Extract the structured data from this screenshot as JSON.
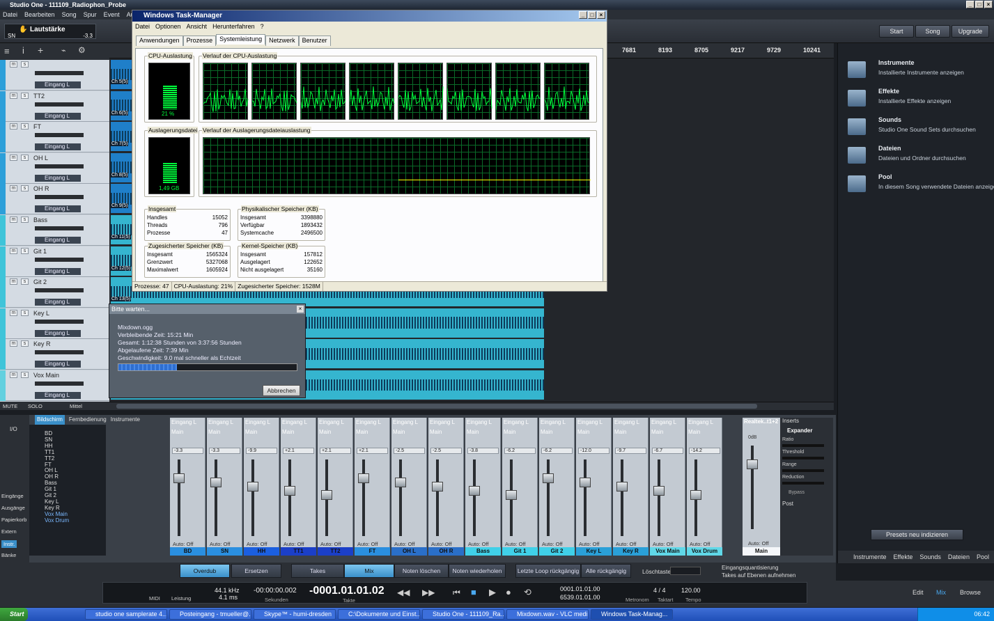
{
  "app": {
    "title": "Studio One - 111109_Radiophon_Probe",
    "menu": [
      "Datei",
      "Bearbeiten",
      "Song",
      "Spur",
      "Event",
      "Audio"
    ]
  },
  "toolbar": {
    "volume_label": "Lautstärke",
    "sn": "SN",
    "volume_value": "-3.3",
    "start": "Start",
    "song": "Song",
    "upgrade": "Upgrade"
  },
  "ruler": [
    "7681",
    "8193",
    "8705",
    "9217",
    "9729",
    "10241"
  ],
  "tracks": [
    {
      "name": "",
      "input": "Eingang L",
      "color": "#2d9fd9"
    },
    {
      "name": "TT2",
      "input": "Eingang L",
      "color": "#2d9fd9"
    },
    {
      "name": "FT",
      "input": "Eingang L",
      "color": "#2d9fd9"
    },
    {
      "name": "OH L",
      "input": "Eingang L",
      "color": "#2d9fd9"
    },
    {
      "name": "OH R",
      "input": "Eingang L",
      "color": "#2d9fd9"
    },
    {
      "name": "Bass",
      "input": "Eingang L",
      "color": "#3fc4d9"
    },
    {
      "name": "Git 1",
      "input": "Eingang L",
      "color": "#3fc4d9"
    },
    {
      "name": "Git 2",
      "input": "Eingang L",
      "color": "#3fc4d9"
    },
    {
      "name": "Key L",
      "input": "Eingang L",
      "color": "#3fc4d9"
    },
    {
      "name": "Key R",
      "input": "Eingang L",
      "color": "#3fc4d9"
    },
    {
      "name": "Vox Main",
      "input": "Eingang L",
      "color": "#63d0df"
    }
  ],
  "last_track": "Vox Drum",
  "tracklist_footer": {
    "mute": "MUTE",
    "solo": "SOLO",
    "mittel": "Mittel"
  },
  "clip_labels": [
    "Ch 5(5)",
    "Ch 6(5)",
    "Ch 7(5)",
    "Ch 8(5)",
    "Ch 9(5)",
    "Ch 11(5)",
    "Ch 12(5)",
    "Ch 13(5)"
  ],
  "taskmanager": {
    "title": "Windows Task-Manager",
    "menu": [
      "Datei",
      "Optionen",
      "Ansicht",
      "Herunterfahren",
      "?"
    ],
    "tabs": [
      "Anwendungen",
      "Prozesse",
      "Systemleistung",
      "Netzwerk",
      "Benutzer"
    ],
    "cpu_label": "CPU-Auslastung",
    "cpu_value": "21 %",
    "cpu_hist_label": "Verlauf der CPU-Auslastung",
    "page_label": "Auslagerungsdatei",
    "page_value": "1,49 GB",
    "page_hist_label": "Verlauf der Auslagerungsdateiauslastung",
    "totals": {
      "label": "Insgesamt",
      "rows": [
        [
          "Handles",
          "15052"
        ],
        [
          "Threads",
          "796"
        ],
        [
          "Prozesse",
          "47"
        ]
      ]
    },
    "physical": {
      "label": "Physikalischer Speicher (KB)",
      "rows": [
        [
          "Insgesamt",
          "3398880"
        ],
        [
          "Verfügbar",
          "1893432"
        ],
        [
          "Systemcache",
          "2496500"
        ]
      ]
    },
    "commit": {
      "label": "Zugesicherter Speicher (KB)",
      "rows": [
        [
          "Insgesamt",
          "1565324"
        ],
        [
          "Grenzwert",
          "5327068"
        ],
        [
          "Maximalwert",
          "1605924"
        ]
      ]
    },
    "kernel": {
      "label": "Kernel-Speicher (KB)",
      "rows": [
        [
          "Insgesamt",
          "157812"
        ],
        [
          "Ausgelagert",
          "122652"
        ],
        [
          "Nicht ausgelagert",
          "35160"
        ]
      ]
    },
    "status": [
      "Prozesse: 47",
      "CPU-Auslastung: 21%",
      "Zugesicherter Speicher: 1528M"
    ],
    "cpu_fraction": 0.21
  },
  "wait": {
    "title": "Bitte warten...",
    "file": "Mixdown.ogg",
    "remaining": "Verbleibende Zeit:  15:21 Min",
    "total": "Gesamt: 1:12:38 Stunden von 3:37:56 Stunden",
    "elapsed": "Abgelaufene Zeit: 7:39 Min",
    "speed": "Geschwindigkeit: 9.0 mal schneller als Echtzeit",
    "cancel": "Abbrechen",
    "progress": 0.33
  },
  "browser": [
    {
      "title": "Instrumente",
      "sub": "Installierte Instrumente anzeigen",
      "icon": "instruments-icon"
    },
    {
      "title": "Effekte",
      "sub": "Installierte Effekte anzeigen",
      "icon": "effects-icon"
    },
    {
      "title": "Sounds",
      "sub": "Studio One Sound Sets durchsuchen",
      "icon": "sounds-icon"
    },
    {
      "title": "Dateien",
      "sub": "Dateien und Ordner durchsuchen",
      "icon": "folder-icon"
    },
    {
      "title": "Pool",
      "sub": "In diesem Song verwendete Dateien anzeigen",
      "icon": "pool-icon"
    }
  ],
  "browser_presets": "Presets neu indizieren",
  "browser_tabs": [
    "Instrumente",
    "Effekte",
    "Sounds",
    "Dateien",
    "Pool"
  ],
  "console_left": {
    "tabs": [
      "Bildschirm",
      "Fernbedienung",
      "Instrumente"
    ],
    "io": "I/O",
    "list": [
      "BD",
      "SN",
      "HH",
      "TT1",
      "TT2",
      "FT",
      "OH L",
      "OH R",
      "Bass",
      "Git 1",
      "Git 2",
      "Key L",
      "Key R",
      "Vox Main",
      "Vox Drum"
    ],
    "side": [
      "Eingänge",
      "Ausgänge",
      "Papierkorb",
      "Extern",
      "Instr.",
      "Bänke"
    ]
  },
  "channels": [
    {
      "name": "BD",
      "pan": "-3.3",
      "color": "#2a8fe0"
    },
    {
      "name": "SN",
      "pan": "-3.3",
      "color": "#2a8fe0"
    },
    {
      "name": "HH",
      "pan": "-9.9",
      "color": "#1b5fe0"
    },
    {
      "name": "TT1",
      "pan": "+2.1",
      "color": "#1b3fc8"
    },
    {
      "name": "TT2",
      "pan": "+2.1",
      "color": "#1b3fc8"
    },
    {
      "name": "FT",
      "pan": "+2.1",
      "color": "#2a8fe0"
    },
    {
      "name": "OH L",
      "pan": "-2.5",
      "color": "#2a6fc8"
    },
    {
      "name": "OH R",
      "pan": "-2.5",
      "color": "#2a6fc8"
    },
    {
      "name": "Bass",
      "pan": "-3.8",
      "color": "#40d0e8"
    },
    {
      "name": "Git 1",
      "pan": "-6.2",
      "color": "#40d0e8"
    },
    {
      "name": "Git 2",
      "pan": "-6.2",
      "color": "#40d0e8"
    },
    {
      "name": "Key L",
      "pan": "-12.0",
      "color": "#2aa0d8"
    },
    {
      "name": "Key R",
      "pan": "-9.7",
      "color": "#2aa0d8"
    },
    {
      "name": "Vox Main",
      "pan": "-6.7",
      "color": "#60d8e8"
    },
    {
      "name": "Vox Drum",
      "pan": "-14.2",
      "color": "#60d8e8"
    }
  ],
  "channel_input": "Eingang L",
  "channel_main": "Main",
  "auto_off": "Auto: Off",
  "main_strip": {
    "title": "Realtek..t1+2",
    "db": "0dB",
    "name": "Main",
    "auto": "Auto: Off"
  },
  "inserts": {
    "title": "Inserts",
    "plugin": "Expander",
    "params": [
      "Ratio",
      "Threshold",
      "Range",
      "Reduction"
    ],
    "bypass": "Bypass",
    "post": "Post"
  },
  "bottombar": {
    "overdub": "Overdub",
    "ersetzen": "Ersetzen",
    "takes": "Takes",
    "mix": "Mix",
    "noten_loeschen": "Noten löschen",
    "noten_wieder": "Noten wiederholen",
    "letzte": "Letzte Loop rückgängig",
    "alle": "Alle rückgängig",
    "loeschtaste": "Löschtaste",
    "eq1": "Eingangsquantisierung",
    "eq2": "Takes auf Ebenen aufnehmen"
  },
  "transport": {
    "midi": "MIDI",
    "leistung": "Leistung",
    "khz": "44.1 kHz",
    "ms": "4.1 ms",
    "sec_val": "-00:00:00.002",
    "sec_lbl": "Sekunden",
    "takte_val": "-0001.01.01.02",
    "takte_lbl": "Takte",
    "l": "0001.01.01.00",
    "r": "6539.01.01.00",
    "metronom": "Metronom",
    "takt_val": "4 / 4",
    "takt_lbl": "Taktart",
    "tempo_val": "120.00",
    "tempo_lbl": "Tempo"
  },
  "modes": [
    "Edit",
    "Mix",
    "Browse"
  ],
  "taskbar": {
    "start": "Start",
    "items": [
      "studio one samplerate 4...",
      "Posteingang - tmueller@...",
      "Skype™ - humi-dresden",
      "C:\\Dokumente und Einst...",
      "Studio One - 111109_Ra...",
      "Mixdown.wav - VLC medi...",
      "Windows Task-Manag..."
    ],
    "clock": "06:42"
  }
}
